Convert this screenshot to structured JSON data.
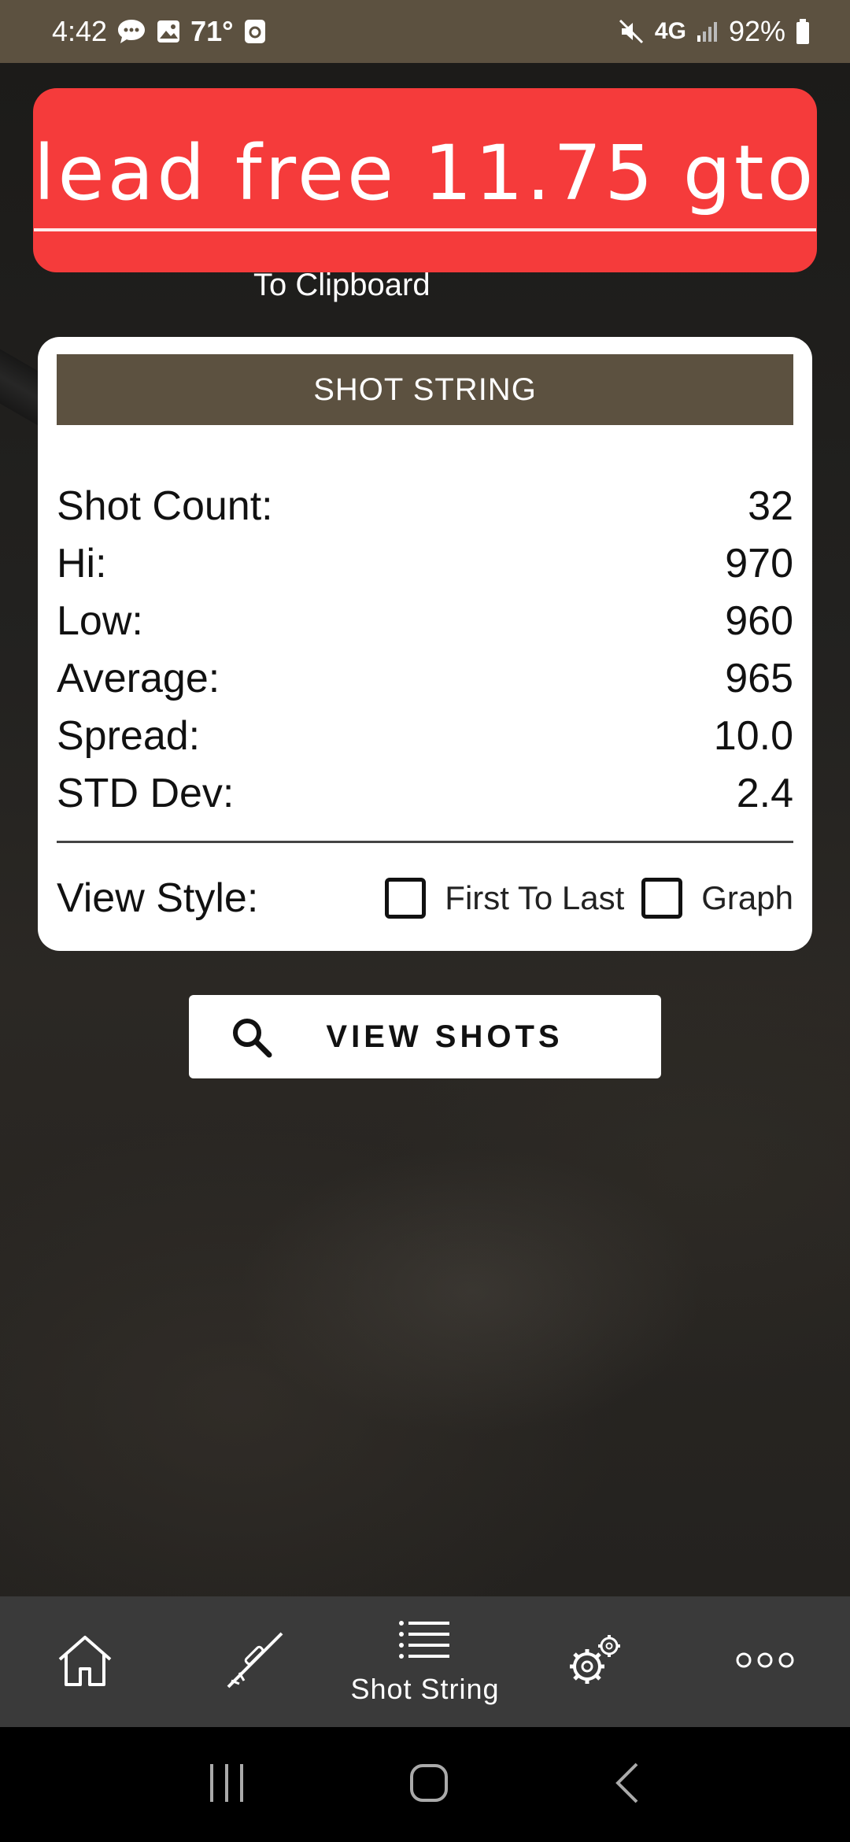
{
  "status_bar": {
    "time": "4:42",
    "temperature": "71°",
    "network": "4G",
    "battery": "92%",
    "icons": [
      "chat-icon",
      "image-icon",
      "app-icon",
      "mute-icon",
      "signal-icon",
      "battery-icon"
    ]
  },
  "banner": {
    "text": "lead free 11.75 gto",
    "color": "#f53b3b"
  },
  "clipboard_label": "To Clipboard",
  "card": {
    "header": "SHOT STRING",
    "stats": [
      {
        "label": "Shot Count:",
        "value": "32"
      },
      {
        "label": "Hi:",
        "value": "970"
      },
      {
        "label": "Low:",
        "value": "960"
      },
      {
        "label": "Average:",
        "value": "965"
      },
      {
        "label": "Spread:",
        "value": "10.0"
      },
      {
        "label": "STD Dev:",
        "value": "2.4"
      }
    ],
    "view_style_label": "View Style:",
    "options": [
      {
        "label": "First To Last",
        "checked": false
      },
      {
        "label": "Graph",
        "checked": false
      }
    ]
  },
  "view_shots_button": "VIEW SHOTS",
  "bottom_nav": {
    "items": [
      {
        "icon": "home-icon",
        "label": ""
      },
      {
        "icon": "rifle-icon",
        "label": ""
      },
      {
        "icon": "list-icon",
        "label": "Shot String"
      },
      {
        "icon": "gears-icon",
        "label": ""
      },
      {
        "icon": "more-icon",
        "label": ""
      }
    ]
  },
  "colors": {
    "accent": "#5c5140",
    "banner": "#f53b3b",
    "nav_bg": "#3a3a3a"
  }
}
